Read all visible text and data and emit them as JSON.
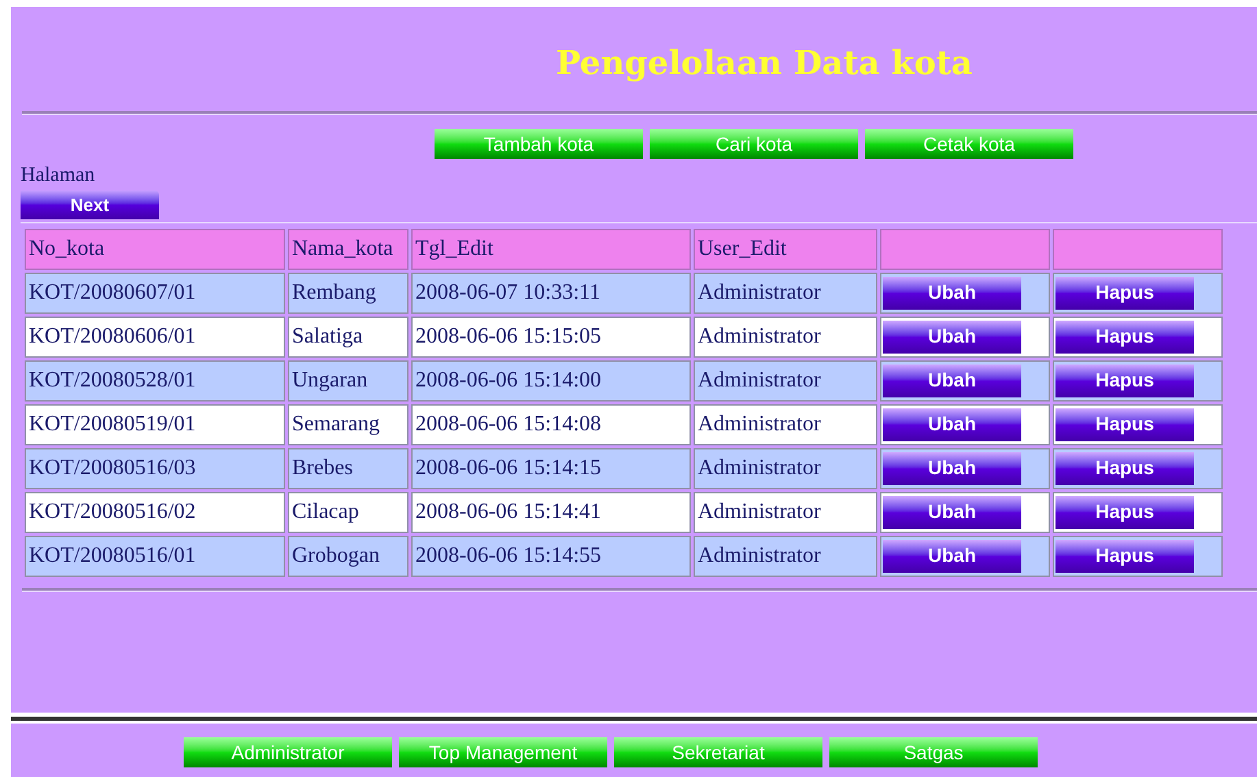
{
  "title": "Pengelolaan Data kota",
  "actions": [
    "Tambah kota",
    "Cari kota",
    "Cetak kota"
  ],
  "paging": {
    "label": "Halaman",
    "next": "Next"
  },
  "table": {
    "columns": [
      "No_kota",
      "Nama_kota",
      "Tgl_Edit",
      "User_Edit"
    ],
    "rows": [
      {
        "cells": [
          "KOT/20080607/01",
          "Rembang",
          "2008-06-07 10:33:11",
          "Administrator"
        ],
        "edit": "Ubah",
        "delete": "Hapus"
      },
      {
        "cells": [
          "KOT/20080606/01",
          "Salatiga",
          "2008-06-06 15:15:05",
          "Administrator"
        ],
        "edit": "Ubah",
        "delete": "Hapus"
      },
      {
        "cells": [
          "KOT/20080528/01",
          "Ungaran",
          "2008-06-06 15:14:00",
          "Administrator"
        ],
        "edit": "Ubah",
        "delete": "Hapus"
      },
      {
        "cells": [
          "KOT/20080519/01",
          "Semarang",
          "2008-06-06 15:14:08",
          "Administrator"
        ],
        "edit": "Ubah",
        "delete": "Hapus"
      },
      {
        "cells": [
          "KOT/20080516/03",
          "Brebes",
          "2008-06-06 15:14:15",
          "Administrator"
        ],
        "edit": "Ubah",
        "delete": "Hapus"
      },
      {
        "cells": [
          "KOT/20080516/02",
          "Cilacap",
          "2008-06-06 15:14:41",
          "Administrator"
        ],
        "edit": "Ubah",
        "delete": "Hapus"
      },
      {
        "cells": [
          "KOT/20080516/01",
          "Grobogan",
          "2008-06-06 15:14:55",
          "Administrator"
        ],
        "edit": "Ubah",
        "delete": "Hapus"
      }
    ]
  },
  "nav": [
    "Administrator",
    "Top Management",
    "Sekretariat",
    "Satgas"
  ]
}
